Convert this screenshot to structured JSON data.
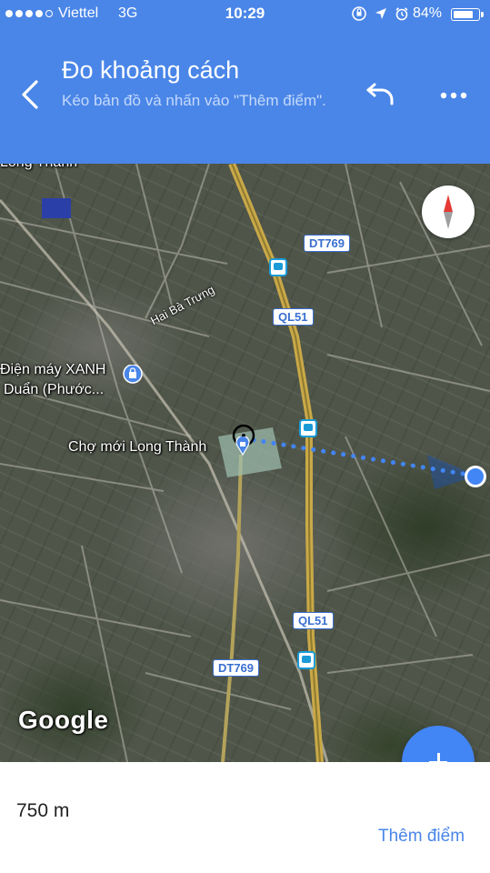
{
  "status_bar": {
    "carrier": "Viettel",
    "network": "3G",
    "time": "10:29",
    "battery_percent": "84%",
    "battery_level": 0.84,
    "icons": [
      "screen-rotation-lock-icon",
      "location-arrow-icon",
      "alarm-icon"
    ]
  },
  "header": {
    "title": "Đo khoảng cách",
    "subtitle": "Kéo bản đồ và nhấn vào \"Thêm điểm\".",
    "background_color": "#4a86e8",
    "back_icon": "back-arrow-icon",
    "undo_icon": "undo-icon",
    "more_icon": "more-horizontal-icon"
  },
  "map": {
    "road_shields": {
      "dt769_top": "DT769",
      "ql51_top": "QL51",
      "ql51_bottom": "QL51",
      "dt769_bottom": "DT769"
    },
    "labels": {
      "top_cut": "Long Thành",
      "street": "Hai Bà Trưng",
      "store_line1": "Điện máy XANH",
      "store_line2": "Duẩn (Phước...",
      "market": "Chợ mới Long Thành"
    },
    "google_logo": "Google",
    "measure_line_color": "#4285f4"
  },
  "fab": {
    "icon": "plus-icon"
  },
  "bottom": {
    "distance": "750 m",
    "add_point_label": "Thêm điểm"
  }
}
